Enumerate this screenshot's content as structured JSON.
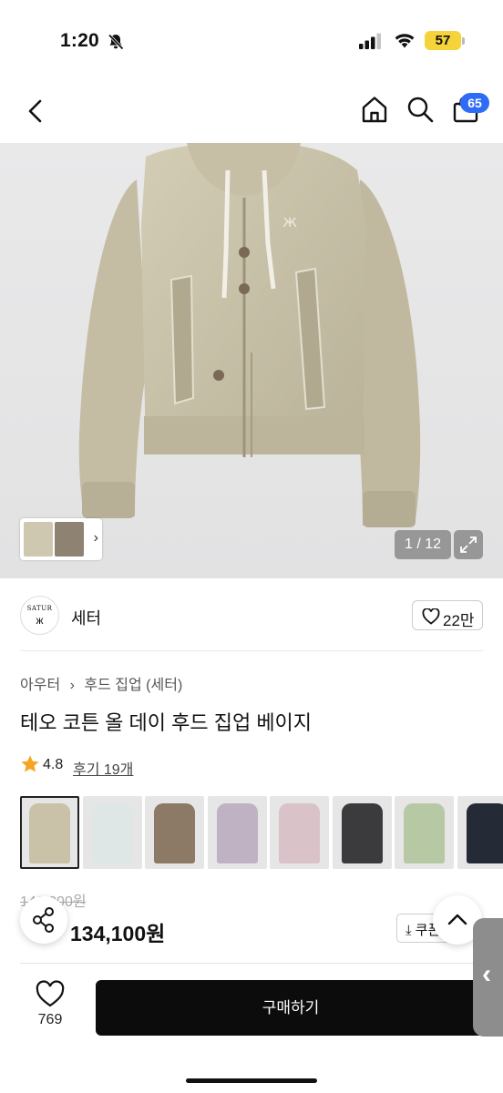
{
  "status_bar": {
    "time": "1:20",
    "battery": "57",
    "battery_color": "#f5d33b"
  },
  "nav": {
    "back_icon": "chevron-left-icon",
    "home_icon": "home-icon",
    "search_icon": "search-icon",
    "cart_icon": "shopping-bag-icon",
    "cart_count": "65",
    "badge_color": "#2f6cf6"
  },
  "gallery": {
    "page_indicator": "1 / 12",
    "expand_icon": "expand-icon"
  },
  "shop": {
    "logo_text": "SATUR",
    "logo_mark": "ж",
    "name": "세터",
    "like_count": "22만"
  },
  "product": {
    "breadcrumb": [
      "아우터",
      "후드 집업 (세터)"
    ],
    "title": "테오 코튼 올 데이 후드 집업 베이지",
    "rating": "4.8",
    "review_link": "후기 19개",
    "original_price": "149,000원",
    "sale_price": "134,100원",
    "coupon_label": "⤓ 쿠폰"
  },
  "color_options": [
    {
      "name": "beige",
      "color": "#c9c2a8",
      "selected": true
    },
    {
      "name": "mint",
      "color": "#dfe7e6",
      "selected": false
    },
    {
      "name": "brown",
      "color": "#8c7a67",
      "selected": false
    },
    {
      "name": "lavender",
      "color": "#bfb2c2",
      "selected": false
    },
    {
      "name": "pink",
      "color": "#d9c2c8",
      "selected": false
    },
    {
      "name": "charcoal",
      "color": "#3b3b3d",
      "selected": false
    },
    {
      "name": "model-photo",
      "color": "#b7c9a4",
      "selected": false
    },
    {
      "name": "navy",
      "color": "#252a37",
      "selected": false
    }
  ],
  "bottom_bar": {
    "wishlist_count": "769",
    "buy_label": "구매하기"
  }
}
